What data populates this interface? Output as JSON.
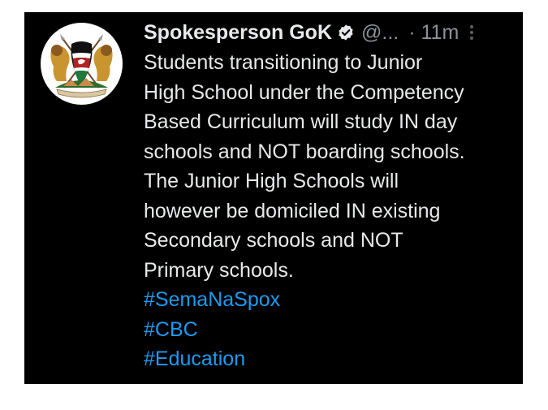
{
  "tweet": {
    "author_name": "Spokesperson GoK",
    "verified": true,
    "handle": "@...",
    "time": "· 11m",
    "lines": [
      "Students transitioning to Junior",
      "High School under the Competency",
      "Based Curriculum will study IN day",
      "schools and NOT boarding schools.",
      "The Junior High Schools will",
      "however be domiciled IN existing",
      "Secondary schools and NOT",
      "Primary schools."
    ],
    "hashtags": [
      "#SemaNaSpox",
      "#CBC",
      "#Education"
    ]
  },
  "icons": {
    "avatar": "kenya-coat-of-arms-icon",
    "verified": "verified-badge-icon",
    "more": "more-vertical-icon"
  },
  "colors": {
    "background": "#000000",
    "text": "#e7e9ea",
    "muted": "#8b9196",
    "link": "#1d9bf0"
  }
}
